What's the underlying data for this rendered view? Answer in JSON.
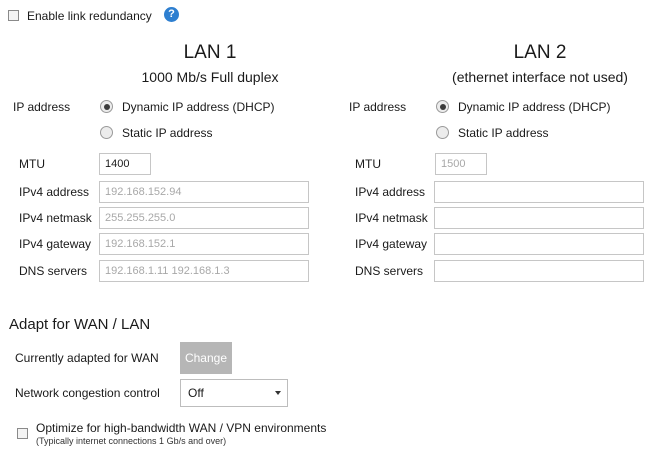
{
  "redundancy": {
    "label": "Enable link redundancy",
    "checked": false,
    "help_icon": "question-circle-icon",
    "help_glyph": "?"
  },
  "lan1": {
    "title": "LAN 1",
    "subtitle": "1000 Mb/s Full duplex",
    "ip_address_label": "IP address",
    "dhcp_label": "Dynamic IP address (DHCP)",
    "static_label": "Static IP address",
    "mode": "dhcp",
    "mtu_label": "MTU",
    "mtu_value": "1400",
    "ipv4_address_label": "IPv4 address",
    "ipv4_address_value": "192.168.152.94",
    "ipv4_netmask_label": "IPv4 netmask",
    "ipv4_netmask_value": "255.255.255.0",
    "ipv4_gateway_label": "IPv4 gateway",
    "ipv4_gateway_value": "192.168.152.1",
    "dns_label": "DNS servers",
    "dns_value": "192.168.1.11 192.168.1.3"
  },
  "lan2": {
    "title": "LAN 2",
    "subtitle": "(ethernet interface not used)",
    "ip_address_label": "IP address",
    "dhcp_label": "Dynamic IP address (DHCP)",
    "static_label": "Static IP address",
    "mode": "dhcp",
    "mtu_label": "MTU",
    "mtu_value": "1500",
    "ipv4_address_label": "IPv4 address",
    "ipv4_address_value": "",
    "ipv4_netmask_label": "IPv4 netmask",
    "ipv4_netmask_value": "",
    "ipv4_gateway_label": "IPv4 gateway",
    "ipv4_gateway_value": "",
    "dns_label": "DNS servers",
    "dns_value": ""
  },
  "adapt": {
    "title": "Adapt for WAN / LAN",
    "currently_label": "Currently adapted for WAN",
    "change_label": "Change",
    "congestion_label": "Network congestion control",
    "congestion_value": "Off",
    "optimize_label": "Optimize for high-bandwidth WAN / VPN environments",
    "optimize_note": "(Typically internet connections 1 Gb/s and over)",
    "optimize_checked": false
  },
  "colors": {
    "accent": "#2e7fd0",
    "button_bg": "#b6b6b6",
    "placeholder_text": "#a8a8a8"
  }
}
